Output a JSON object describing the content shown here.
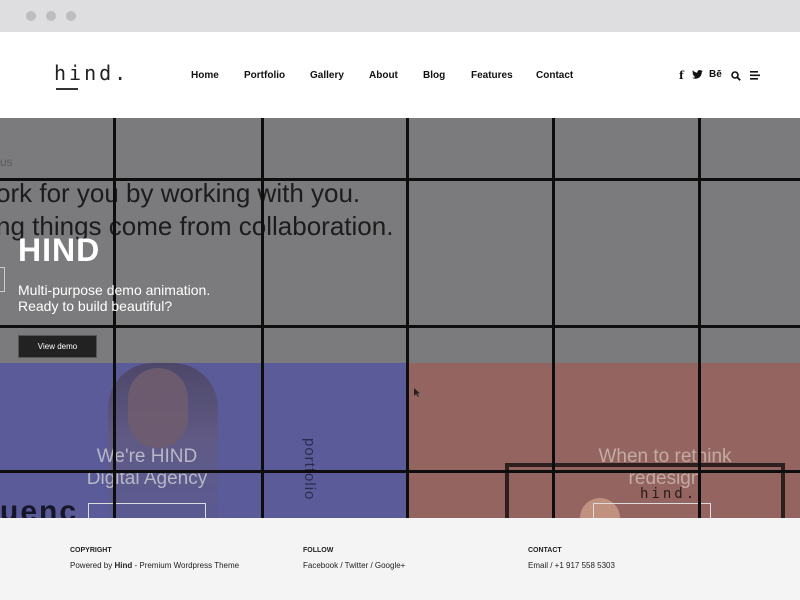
{
  "nav": {
    "logo": "hind.",
    "items": [
      "Home",
      "Portfolio",
      "Gallery",
      "About",
      "Blog",
      "Features",
      "Contact"
    ],
    "social": [
      "facebook-icon",
      "twitter-icon",
      "behance-icon",
      "search-icon",
      "menu-icon"
    ],
    "social_text": {
      "facebook": "f",
      "behance": "Bē"
    }
  },
  "hero": {
    "label_fragment": "US",
    "bg_line_1": "ork for you by working with you.",
    "bg_line_2": "ng things come from collaboration.",
    "title": "HIND",
    "subtitle_line1": "Multi-purpose demo animation.",
    "subtitle_line2": "Ready to build beautiful?",
    "button": "View demo",
    "card_left_line1": "We're HIND",
    "card_left_line2": "Digital Agency",
    "card_right_line1": "When to rethink",
    "card_right_line2": "redesign",
    "vertical_word": "portfolio",
    "bottom_fragment": "uenc",
    "device_logo": "hind."
  },
  "footer": {
    "copyright_heading": "COPYRIGHT",
    "copyright_prefix": "Powered by ",
    "copyright_brand": "Hind",
    "copyright_suffix": " - Premium Wordpress Theme",
    "follow_heading": "FOLLOW",
    "follow_text": "Facebook / Twitter / Google+",
    "contact_heading": "CONTACT",
    "contact_text": "Email / +1 917 558 5303"
  },
  "colors": {
    "hero_overlay": "#7b7b7d",
    "panel_blue": "#5b5b9a",
    "panel_rust": "#946560",
    "footer_bg": "#f4f4f4"
  }
}
